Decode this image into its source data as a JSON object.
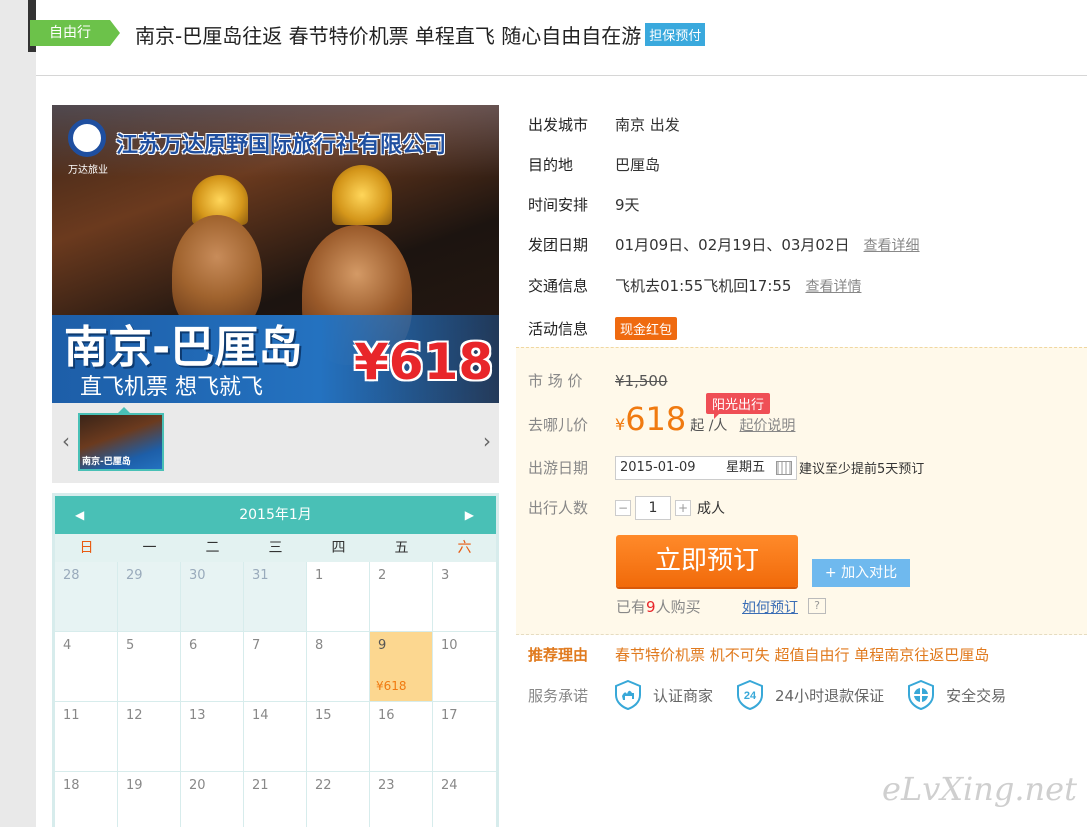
{
  "header": {
    "tag": "自由行",
    "title": "南京-巴厘岛往返 春节特价机票 单程直飞 随心自由自在游",
    "badge": "担保预付"
  },
  "poster": {
    "company": "江苏万达原野国际旅行社有限公司",
    "logo_sub": "万达旅业",
    "route": "南京-巴厘岛",
    "slogan": "直飞机票 想飞就飞",
    "price": "¥618",
    "thumb_caption": "南京-巴厘岛"
  },
  "gallery": {
    "prev": "‹",
    "next": "›"
  },
  "calendar": {
    "month": "2015年1月",
    "prev": "◀",
    "next": "▶",
    "weekdays": [
      "日",
      "一",
      "二",
      "三",
      "四",
      "五",
      "六"
    ],
    "rows": [
      [
        "28",
        "29",
        "30",
        "31",
        "1",
        "2",
        "3"
      ],
      [
        "4",
        "5",
        "6",
        "7",
        "8",
        "9",
        "10"
      ],
      [
        "11",
        "12",
        "13",
        "14",
        "15",
        "16",
        "17"
      ],
      [
        "18",
        "19",
        "20",
        "21",
        "22",
        "23",
        "24"
      ]
    ],
    "price_label": "¥618"
  },
  "info": {
    "depart_label": "出发城市",
    "depart_value": "南京 出发",
    "dest_label": "目的地",
    "dest_value": "巴厘岛",
    "time_label": "时间安排",
    "time_value": "9天",
    "dates_label": "发团日期",
    "dates_value": "01月09日、02月19日、03月02日",
    "dates_link": "查看详细",
    "traffic_label": "交通信息",
    "traffic_value": "飞机去01:55飞机回17:55",
    "traffic_link": "查看详情",
    "activity_label": "活动信息",
    "activity_badge": "现金红包"
  },
  "pricing": {
    "market_label": "市 场 价",
    "market_value": "¥1,500",
    "qunar_label": "去哪儿价",
    "currency": "¥",
    "price": "618",
    "per": "起 /人",
    "price_link": "起价说明",
    "sunshine_badge": "阳光出行",
    "date_label": "出游日期",
    "date_value": "2015-01-09",
    "weekday": "星期五",
    "date_hint": "建议至少提前5天预订",
    "people_label": "出行人数",
    "minus": "−",
    "qty": "1",
    "plus": "+",
    "unit": "成人",
    "book_button": "立即预订",
    "compare_button": "+ 加入对比",
    "bought_prefix": "已有",
    "bought_count": "9",
    "bought_suffix": "人购买",
    "howto_link": "如何预订",
    "help": "?"
  },
  "reason": {
    "label": "推荐理由",
    "value": "春节特价机票 机不可失 超值自由行 单程南京往返巴厘岛"
  },
  "promise": {
    "label": "服务承诺",
    "items": [
      "认证商家",
      "24小时退款保证",
      "安全交易"
    ],
    "badge24": "24"
  },
  "watermark": "eLvXing.net"
}
